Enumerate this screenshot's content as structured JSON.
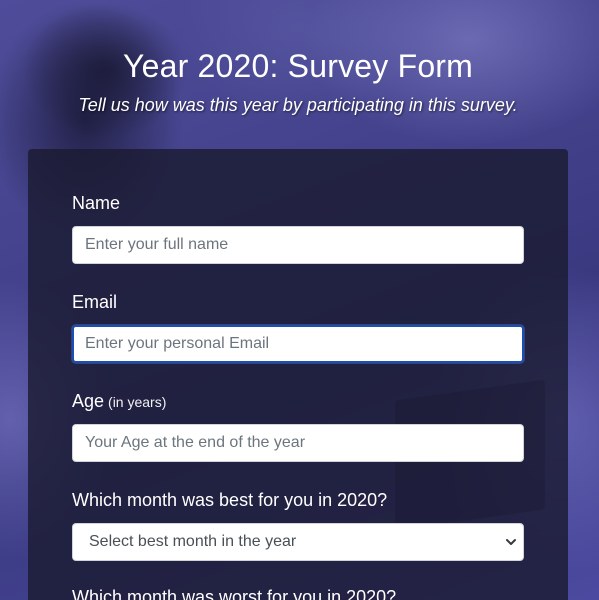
{
  "header": {
    "title": "Year 2020: Survey Form",
    "subtitle": "Tell us how was this year by participating in this survey."
  },
  "form": {
    "name": {
      "label": "Name",
      "placeholder": "Enter your full name",
      "value": ""
    },
    "email": {
      "label": "Email",
      "placeholder": "Enter your personal Email",
      "value": "",
      "focused": true
    },
    "age": {
      "label": "Age",
      "hint": "(in years)",
      "placeholder": "Your Age at the end of the year",
      "value": ""
    },
    "best_month": {
      "label": "Which month was best for you in 2020?",
      "selected": "Select best month in the year",
      "icon": "chevron-down-icon"
    },
    "worst_month": {
      "label": "Which month was worst for you in 2020?"
    }
  },
  "colors": {
    "background": "#44428c",
    "card": "#1b1b32",
    "focus_border": "#1a4fb5",
    "text": "#ffffff"
  }
}
